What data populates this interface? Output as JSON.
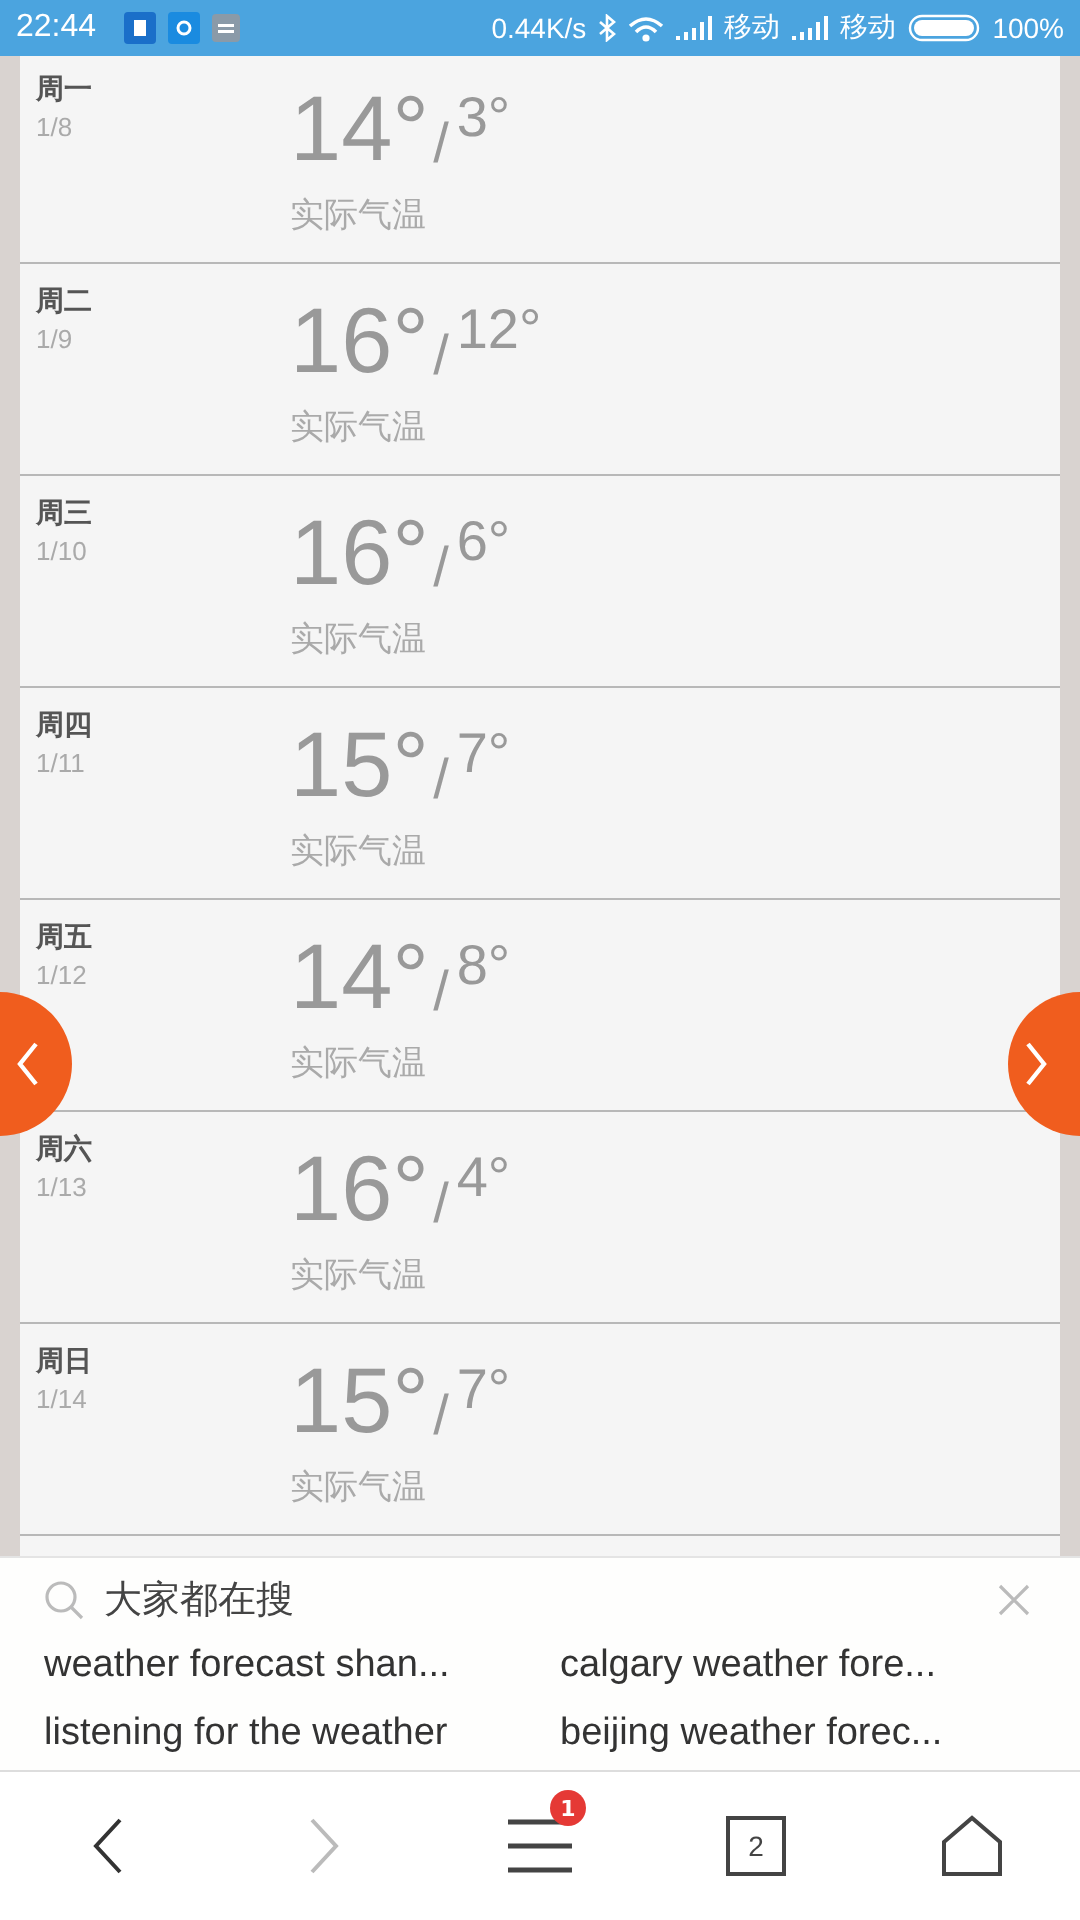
{
  "status_bar": {
    "time": "22:44",
    "speed": "0.44K/s",
    "carriers": [
      "移动",
      "移动"
    ],
    "battery": "100%"
  },
  "days": [
    {
      "day": "周一",
      "date": "1/8",
      "high": "14°",
      "low": "3°",
      "label": "实际气温"
    },
    {
      "day": "周二",
      "date": "1/9",
      "high": "16°",
      "low": "12°",
      "label": "实际气温"
    },
    {
      "day": "周三",
      "date": "1/10",
      "high": "16°",
      "low": "6°",
      "label": "实际气温"
    },
    {
      "day": "周四",
      "date": "1/11",
      "high": "15°",
      "low": "7°",
      "label": "实际气温"
    },
    {
      "day": "周五",
      "date": "1/12",
      "high": "14°",
      "low": "8°",
      "label": "实际气温"
    },
    {
      "day": "周六",
      "date": "1/13",
      "high": "16°",
      "low": "4°",
      "label": "实际气温"
    },
    {
      "day": "周日",
      "date": "1/14",
      "high": "15°",
      "low": "7°",
      "label": "实际气温"
    }
  ],
  "separator": "/",
  "suggestions": {
    "title": "大家都在搜",
    "items": [
      "weather forecast shan...",
      "calgary weather fore...",
      "listening for the weather",
      "beijing weather forec..."
    ]
  },
  "toolbar": {
    "menu_badge": "1",
    "tab_count": "2"
  }
}
